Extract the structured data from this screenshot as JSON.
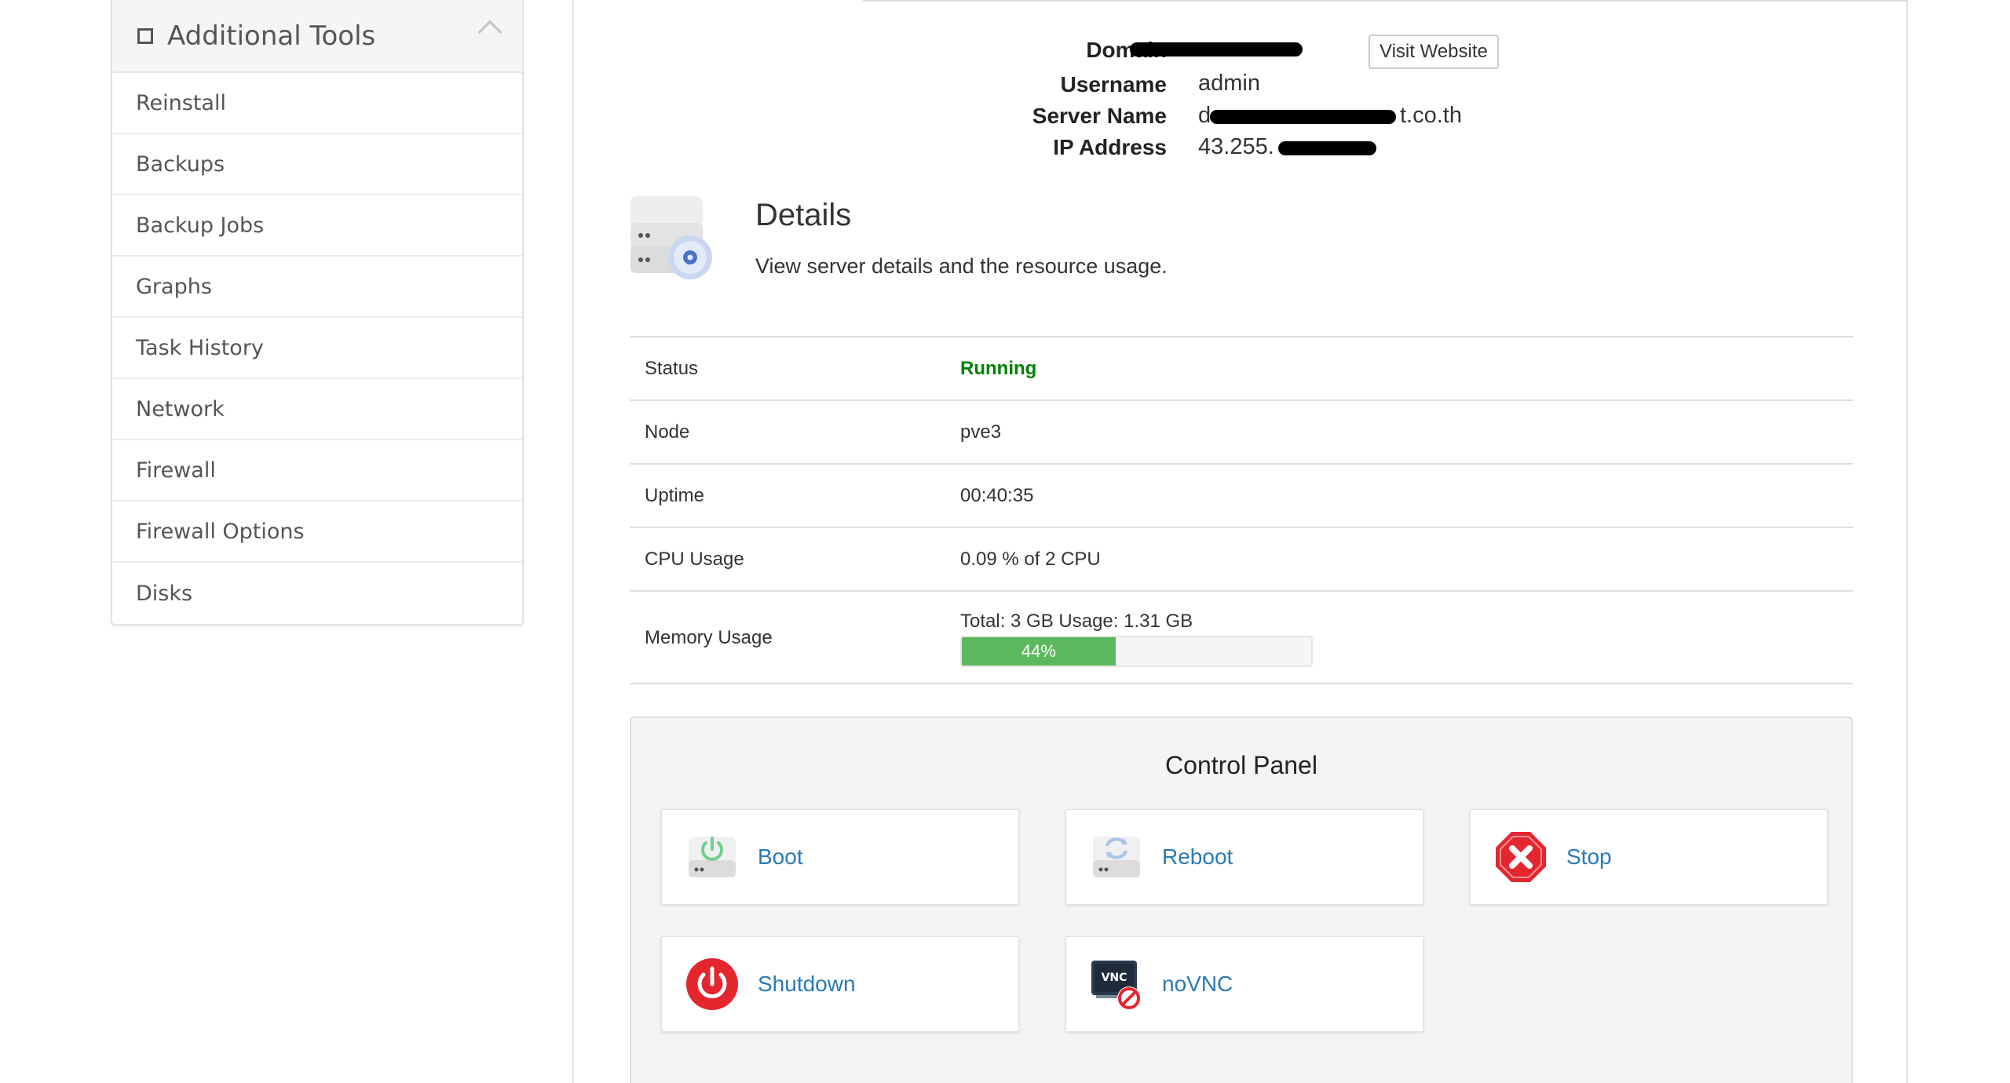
{
  "sidebar": {
    "title": "Additional Tools",
    "items": [
      {
        "label": "Reinstall"
      },
      {
        "label": "Backups"
      },
      {
        "label": "Backup Jobs"
      },
      {
        "label": "Graphs"
      },
      {
        "label": "Task History"
      },
      {
        "label": "Network"
      },
      {
        "label": "Firewall"
      },
      {
        "label": "Firewall Options"
      },
      {
        "label": "Disks"
      }
    ]
  },
  "server_info": {
    "domain_label": "Domain",
    "visit_website_label": "Visit Website",
    "username_label": "Username",
    "username_value": "admin",
    "server_name_label": "Server Name",
    "server_name_prefix": "d",
    "server_name_suffix": "t.co.th",
    "ip_label": "IP Address",
    "ip_prefix": "43.255."
  },
  "details": {
    "title": "Details",
    "subtitle": "View server details and the resource usage.",
    "rows": [
      {
        "label": "Status",
        "value": "Running"
      },
      {
        "label": "Node",
        "value": "pve3"
      },
      {
        "label": "Uptime",
        "value": "00:40:35"
      },
      {
        "label": "CPU Usage",
        "value": "0.09 % of 2 CPU"
      }
    ],
    "memory": {
      "label": "Memory Usage",
      "text": "Total: 3 GB Usage: 1.31 GB",
      "percent": 44,
      "percent_label": "44%"
    }
  },
  "control_panel": {
    "title": "Control Panel",
    "buttons": [
      {
        "label": "Boot",
        "icon": "boot-icon"
      },
      {
        "label": "Reboot",
        "icon": "reboot-icon"
      },
      {
        "label": "Stop",
        "icon": "stop-icon"
      },
      {
        "label": "Shutdown",
        "icon": "shutdown-icon"
      },
      {
        "label": "noVNC",
        "icon": "novnc-icon"
      }
    ]
  },
  "colors": {
    "status_running": "#008000",
    "progress_fill": "#5cb85c",
    "link_blue": "#2a7ab8",
    "stop_red": "#e4262f"
  }
}
